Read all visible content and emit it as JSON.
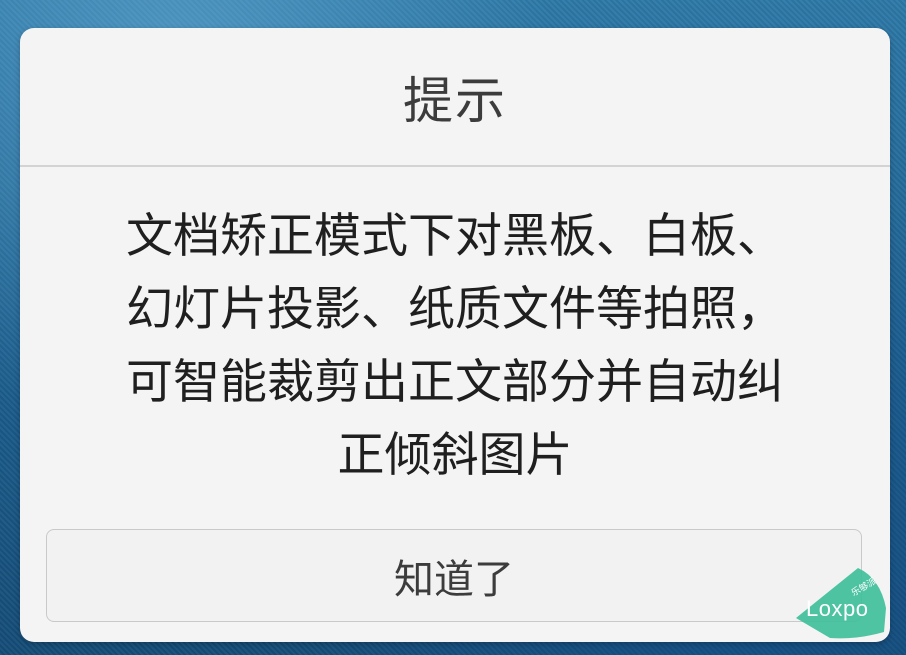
{
  "dialog": {
    "title": "提示",
    "message_lines": [
      "文档矫正模式下对黑板、白板、",
      "幻灯片投影、纸质文件等拍照，",
      "可智能裁剪出正文部分并自动纠",
      "正倾斜图片"
    ],
    "button_label": "知道了"
  },
  "watermark": {
    "brand": "Loxpo",
    "tagline": "乐够派",
    "color": "#3fbf9a"
  }
}
